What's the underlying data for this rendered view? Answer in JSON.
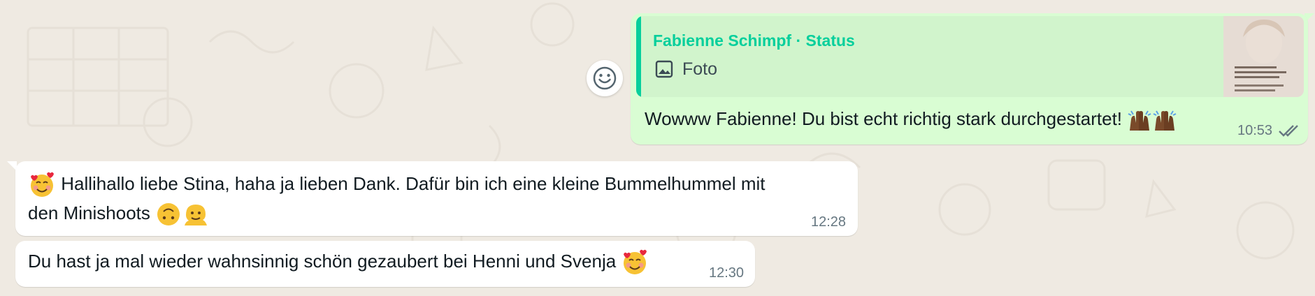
{
  "chat": {
    "outgoing": {
      "quote_author": "Fabienne Schimpf · Status",
      "quote_kind": "Foto",
      "text": "Wowww Fabienne! Du bist echt richtig stark durchgestartet!",
      "emojis": [
        "raising-hands-icon",
        "raising-hands-icon"
      ],
      "time": "10:53",
      "status": "read-double-check-icon"
    },
    "incoming": [
      {
        "line1": "Hallihallo liebe Stina, haha ja lieben Dank. Dafür bin ich eine kleine Bummelhummel mit",
        "line2": "den Minishoots",
        "leading_emoji": "smiling-face-with-hearts-icon",
        "trailing_emojis": [
          "upside-down-face-icon",
          "melting-face-icon"
        ],
        "time": "12:28"
      },
      {
        "text": "Du hast ja mal wieder wahnsinnig schön gezaubert bei Henni und Svenja",
        "trailing_emoji": "smiling-face-with-hearts-icon",
        "time": "12:30"
      }
    ]
  },
  "colors": {
    "background": "#efeae2",
    "outgoing_bubble": "#d9fdd3",
    "quote_accent": "#06cf9c",
    "incoming_bubble": "#ffffff",
    "meta_text": "#667781"
  }
}
